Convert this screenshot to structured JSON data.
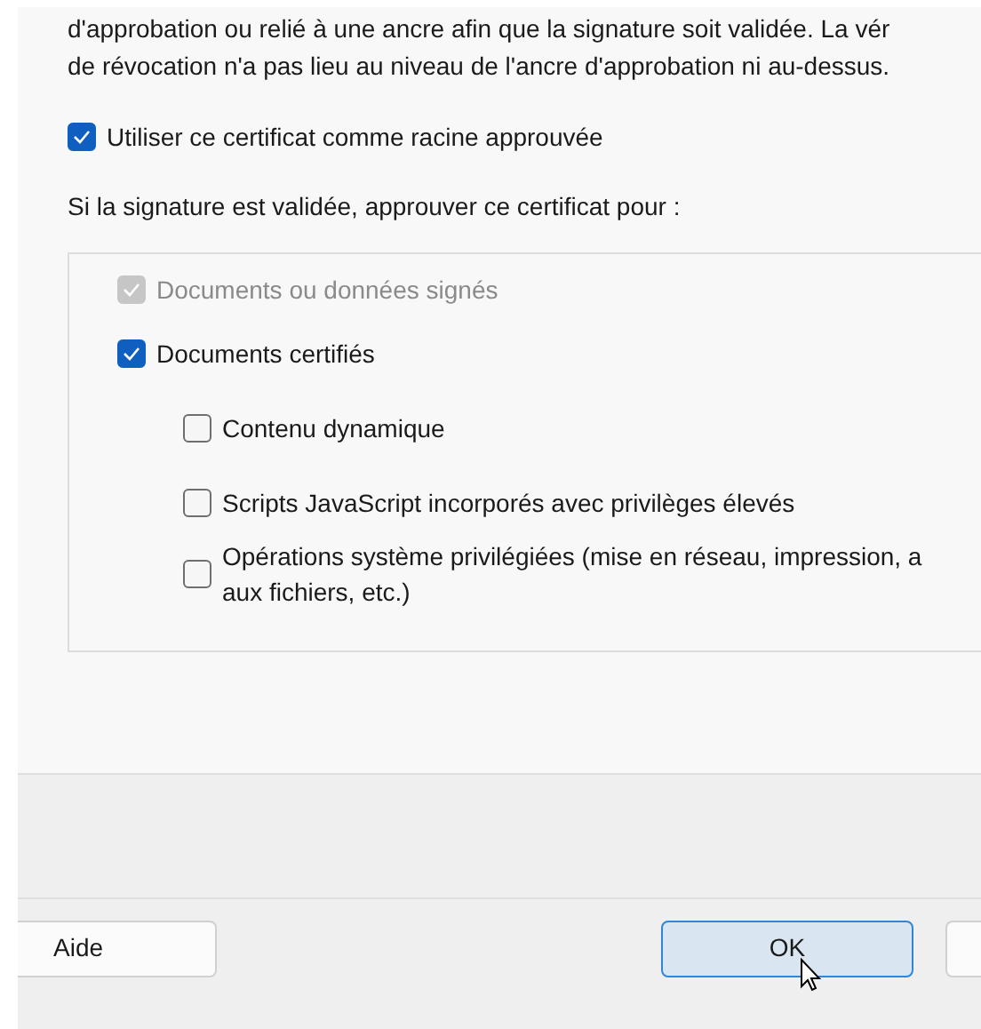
{
  "description_lines": [
    "d'approbation ou relié à une ancre afin que la signature soit validée. La vér",
    "de révocation n'a pas lieu au niveau de l'ancre d'approbation ni au-dessus."
  ],
  "trusted_root": {
    "label": "Utiliser ce certificat comme racine approuvée",
    "checked": true
  },
  "trust_prompt": "Si la signature est validée, approuver ce certificat pour :",
  "trust_options": [
    {
      "label": "Documents ou données signés",
      "checked": true,
      "disabled": true,
      "nested": false
    },
    {
      "label": "Documents certifiés",
      "checked": true,
      "disabled": false,
      "nested": false
    },
    {
      "label": "Contenu dynamique",
      "checked": false,
      "disabled": false,
      "nested": true
    },
    {
      "label": "Scripts JavaScript incorporés avec privilèges élevés",
      "checked": false,
      "disabled": false,
      "nested": true
    },
    {
      "label": "Opérations système privilégiées (mise en réseau, impression, a\naux fichiers, etc.)",
      "checked": false,
      "disabled": false,
      "nested": true
    }
  ],
  "buttons": [
    {
      "label": "Aide",
      "kind": "plain"
    },
    {
      "label": "OK",
      "kind": "default"
    },
    {
      "kind": "cut"
    }
  ]
}
